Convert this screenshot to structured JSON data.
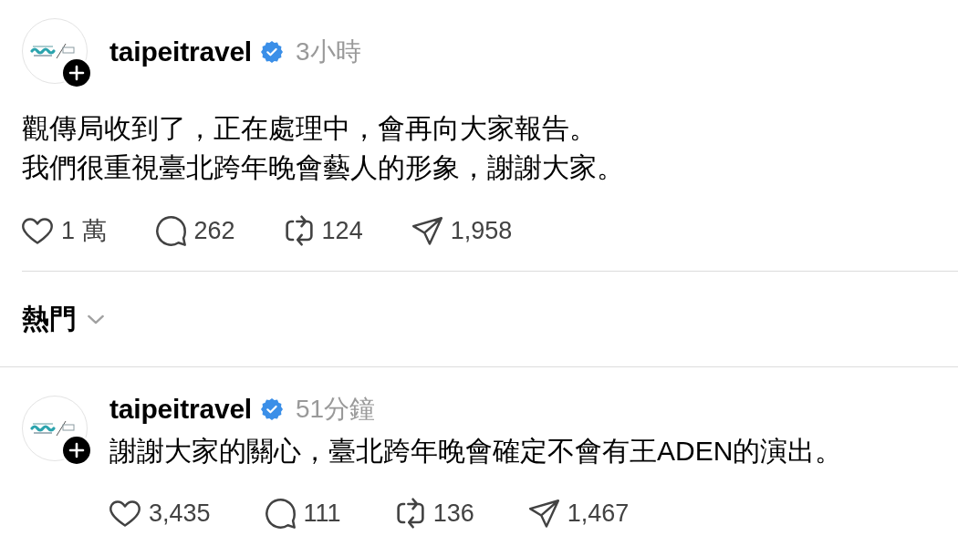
{
  "main_post": {
    "username": "taipeitravel",
    "verified": true,
    "time": "3小時",
    "text_lines": [
      "觀傳局收到了，正在處理中，會再向大家報告。",
      "我們很重視臺北跨年晚會藝人的形象，謝謝大家。"
    ],
    "stats": [
      {
        "kind": "like",
        "count": "1 萬"
      },
      {
        "kind": "reply",
        "count": "262"
      },
      {
        "kind": "repost",
        "count": "124"
      },
      {
        "kind": "share",
        "count": "1,958"
      }
    ]
  },
  "sort_menu": {
    "label": "熱門"
  },
  "replies": [
    {
      "username": "taipeitravel",
      "verified": true,
      "time": "51分鐘",
      "text": "謝謝大家的關心，臺北跨年晚會確定不會有王ADEN的演出。",
      "stats": [
        {
          "kind": "like",
          "count": "3,435"
        },
        {
          "kind": "reply",
          "count": "111"
        },
        {
          "kind": "repost",
          "count": "136"
        },
        {
          "kind": "share",
          "count": "1,467"
        }
      ]
    }
  ]
}
